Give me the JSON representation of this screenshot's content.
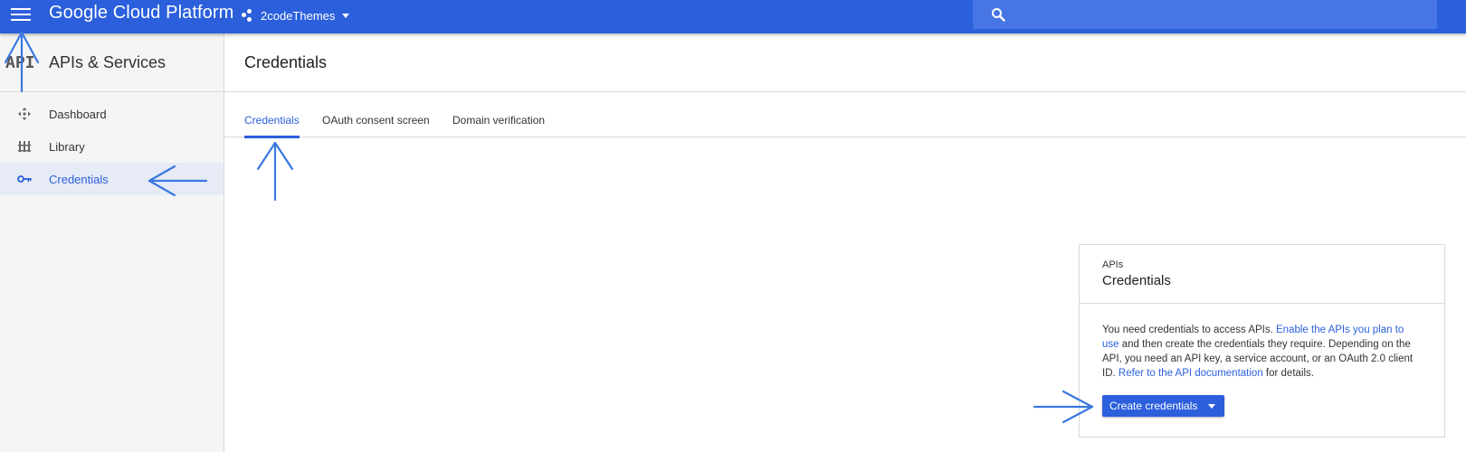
{
  "topbar": {
    "brand": "Google Cloud Platform",
    "project_name": "2codeThemes",
    "search_placeholder": ""
  },
  "sidebar": {
    "logo_text": "API",
    "title": "APIs & Services",
    "items": [
      {
        "label": "Dashboard",
        "icon": "dashboard-icon"
      },
      {
        "label": "Library",
        "icon": "library-icon"
      },
      {
        "label": "Credentials",
        "icon": "key-icon",
        "active": true
      }
    ]
  },
  "page": {
    "title": "Credentials",
    "tabs": [
      {
        "label": "Credentials",
        "active": true
      },
      {
        "label": "OAuth consent screen"
      },
      {
        "label": "Domain verification"
      }
    ]
  },
  "card": {
    "kicker": "APIs",
    "title": "Credentials",
    "body_text_1": "You need credentials to access APIs. ",
    "link_1": "Enable the APIs you plan to use",
    "body_text_2": " and then create the credentials they require. Depending on the API, you need an API key, a service account, or an OAuth 2.0 client ID. ",
    "link_2": "Refer to the API documentation",
    "body_text_3": " for details.",
    "button_label": "Create credentials"
  },
  "colors": {
    "brand_blue": "#2b5fdc",
    "search_bg": "#4775e4",
    "sidebar_bg": "#f5f5f5",
    "active_bg": "#e6ebf6",
    "annotation_arrow": "#3a78e0"
  }
}
